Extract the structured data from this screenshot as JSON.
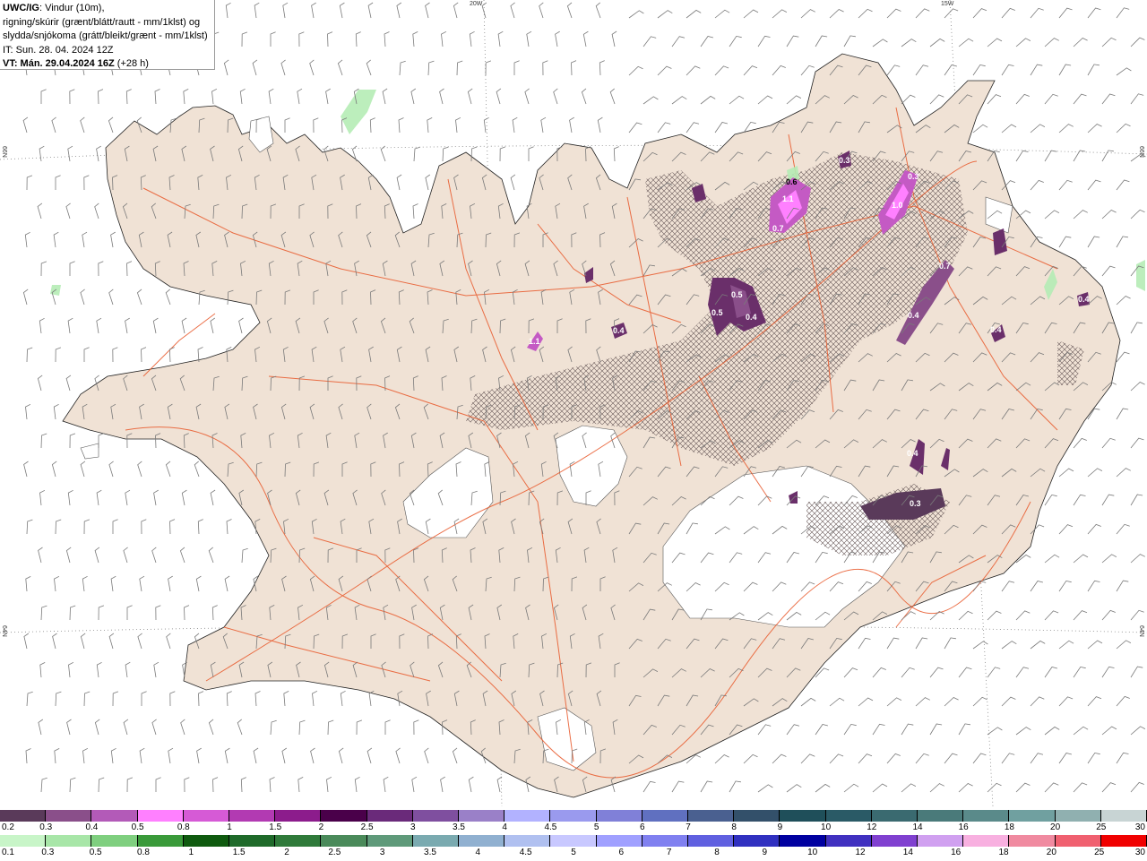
{
  "header": {
    "product": "UWC/IG",
    "line1_rest": ": Vindur (10m),",
    "line2": "rigning/skúrir (grænt/blátt/rautt - mm/1klst) og",
    "line3": "slydda/snjókoma (grátt/bleikt/grænt - mm/1klst)",
    "init_time": "IT: Sun. 28. 04. 2024 12Z",
    "valid_label": "VT: Mán. 29.04.2024 16Z",
    "lead_time": "(+28 h)"
  },
  "graticule": {
    "lon_20w": "20W",
    "lon_15w": "15W",
    "lat_66n_left": "66N",
    "lat_66n_right": "66N",
    "lat_64n_left": "64N",
    "lat_64n_right": "64N"
  },
  "precip_labels": [
    {
      "text": "0.6"
    },
    {
      "text": "1.1"
    },
    {
      "text": "0.7"
    },
    {
      "text": "0.3"
    },
    {
      "text": "0.3"
    },
    {
      "text": "1.0"
    },
    {
      "text": "0.5"
    },
    {
      "text": "0.5"
    },
    {
      "text": "0.4"
    },
    {
      "text": "0.4"
    },
    {
      "text": "1.1"
    },
    {
      "text": "0.7"
    },
    {
      "text": "0.4"
    },
    {
      "text": "0.4"
    },
    {
      "text": "0.4"
    },
    {
      "text": "0.4"
    },
    {
      "text": "0.3"
    }
  ],
  "legend_snow": {
    "labels": [
      "0.2",
      "0.3",
      "0.4",
      "0.5",
      "0.8",
      "1",
      "1.5",
      "2",
      "2.5",
      "3",
      "3.5",
      "4",
      "4.5",
      "5",
      "6",
      "7",
      "8",
      "9",
      "10",
      "12",
      "14",
      "16",
      "18",
      "20",
      "25",
      "30"
    ],
    "colors": [
      "#5a3a5a",
      "#8a4f8a",
      "#b35ab8",
      "#ff80ff",
      "#d65ad6",
      "#b23ab2",
      "#8c1c8c",
      "#4a004a",
      "#6a2a7a",
      "#7f4f9f",
      "#9a80c8",
      "#b2b2ff",
      "#9a9aee",
      "#8080d8",
      "#6070c0",
      "#4a6090",
      "#33506a",
      "#1f4f5a",
      "#2a5a66",
      "#3a6a70",
      "#4a7a7a",
      "#5a8a8a",
      "#70a0a0",
      "#90b0b0",
      "#c8d4d4"
    ]
  },
  "legend_rain": {
    "labels": [
      "0.1",
      "0.3",
      "0.5",
      "0.8",
      "1",
      "1.5",
      "2",
      "2.5",
      "3",
      "3.5",
      "4",
      "4.5",
      "5",
      "6",
      "7",
      "8",
      "9",
      "10",
      "12",
      "14",
      "16",
      "18",
      "20",
      "25",
      "30"
    ],
    "colors": [
      "#c8f5c8",
      "#a8e6a8",
      "#7fcf7f",
      "#3a9a3a",
      "#0f5a0f",
      "#1f6a2a",
      "#2f7a3a",
      "#4a8a5a",
      "#5f9a7a",
      "#7aaab0",
      "#90b0d0",
      "#b0c0f0",
      "#c8c8ff",
      "#a0a0ff",
      "#8080f0",
      "#6060e0",
      "#3030c0",
      "#0000a0",
      "#4030c0",
      "#8040d0",
      "#d0a0f0",
      "#f8b0e0",
      "#f08aa0",
      "#f06070",
      "#f00000"
    ]
  }
}
